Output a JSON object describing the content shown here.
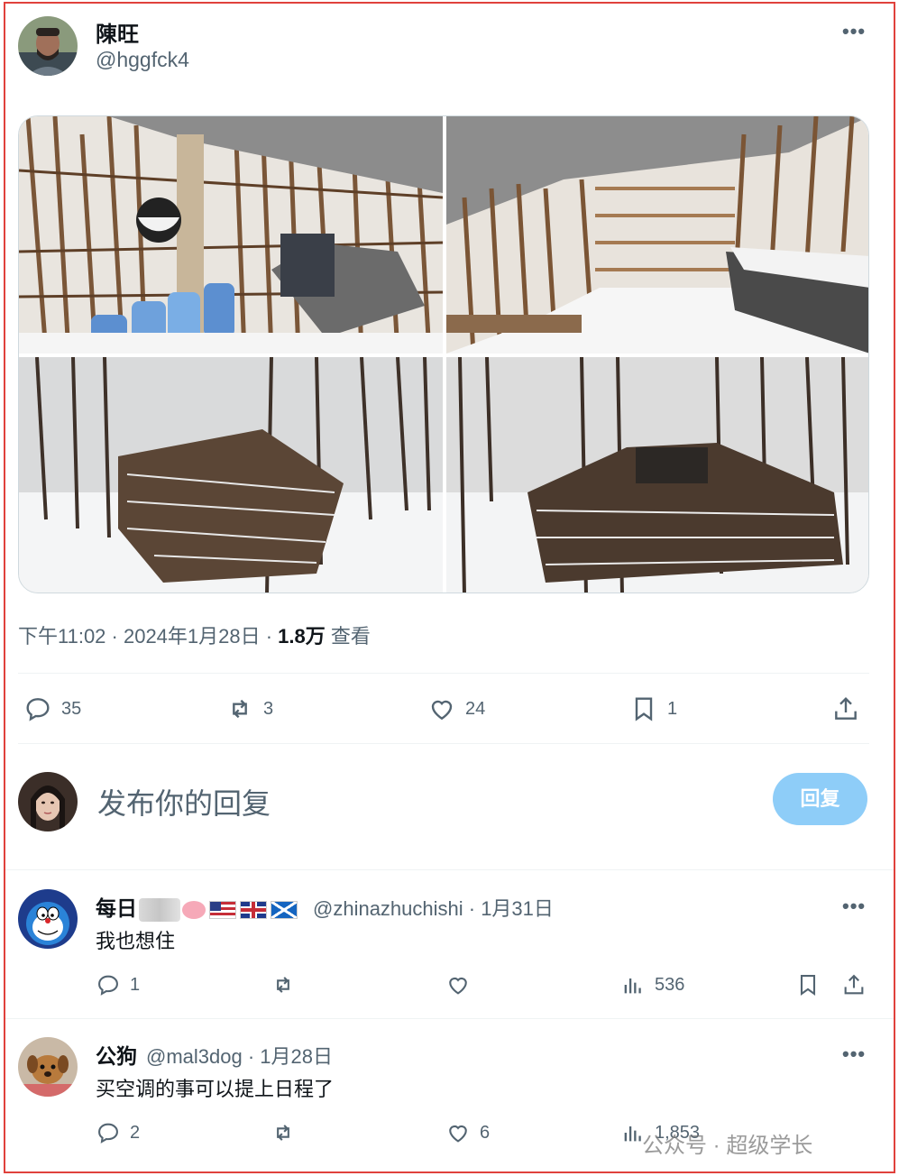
{
  "post": {
    "author_name": "陳旺",
    "author_handle": "@hggfck4",
    "more": "•••",
    "timestamp": "下午11:02 · 2024年1月28日 · ",
    "views_count": "1.8万",
    "views_label": " 查看",
    "stats": {
      "replies": "35",
      "retweets": "3",
      "likes": "24",
      "bookmarks": "1"
    }
  },
  "reply_box": {
    "placeholder": "发布你的回复",
    "button_label": "回复"
  },
  "comments": [
    {
      "name": "每日",
      "handle_date": "@zhinazhuchishi · 1月31日",
      "text": "我也想住",
      "replies": "1",
      "retweets": "",
      "likes": "",
      "views": "536",
      "more": "•••"
    },
    {
      "name": "公狗",
      "handle_date": "@mal3dog · 1月28日",
      "text": "买空调的事可以提上日程了",
      "replies": "2",
      "retweets": "",
      "likes": "6",
      "views": "1,853",
      "more": "•••"
    }
  ],
  "watermark": "公众号 · 超级学长",
  "colors": {
    "accent": "#1d9bf0",
    "reply_button": "#8ecdf8",
    "frame": "#e0413c",
    "muted": "#536471"
  },
  "icons": [
    "reply-icon",
    "retweet-icon",
    "like-icon",
    "bookmark-icon",
    "share-icon",
    "views-icon",
    "more-icon"
  ]
}
